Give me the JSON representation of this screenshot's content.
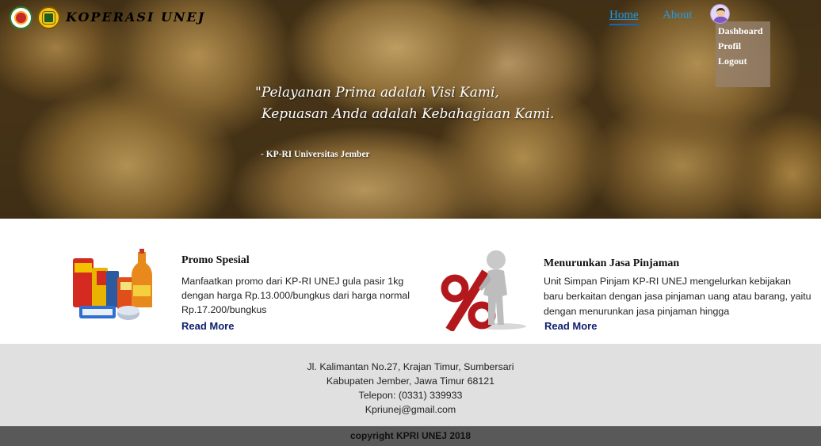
{
  "header": {
    "brand": "KOPERASI UNEJ",
    "nav": {
      "home": "Home",
      "about": "About"
    },
    "user_menu": [
      "Dashboard",
      "Profil",
      "Logout"
    ]
  },
  "hero": {
    "quote_line1": "\"Pelayanan Prima adalah Visi Kami,",
    "quote_line2": "Kepuasan Anda adalah Kebahagiaan Kami.",
    "signature": "- KP-RI Universitas Jember"
  },
  "cards": [
    {
      "title": "Promo Spesial",
      "text": "Manfaatkan promo dari KP-RI UNEJ gula pasir 1kg dengan harga Rp.13.000/bungkus dari harga normal Rp.17.200/bungkus",
      "link": "Read More",
      "image": "grocery-products-image"
    },
    {
      "title": "Menurunkan Jasa Pinjaman",
      "text": "Unit Simpan Pinjam KP-RI UNEJ mengelurkan kebijakan baru berkaitan dengan jasa pinjaman uang atau barang, yaitu dengan menurunkan jasa pinjaman hingga",
      "link": "Read More",
      "image": "percent-figure-image"
    }
  ],
  "footer": {
    "address1": "Jl. Kalimantan No.27, Krajan Timur, Sumbersari",
    "address2": "Kabupaten Jember, Jawa Timur 68121",
    "phone": "Telepon: (0331) 339933",
    "email": "Kpriunej@gmail.com",
    "copyright": "copyright KPRI UNEJ 2018"
  },
  "colors": {
    "nav_link": "#1e9be6",
    "read_more": "#10206b",
    "footer_bg": "#e0e0e0",
    "copyright_bg": "#595959"
  }
}
